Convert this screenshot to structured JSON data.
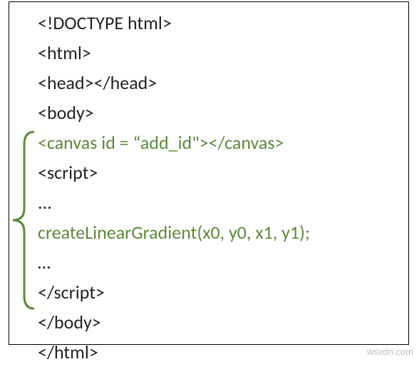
{
  "code": {
    "line1": "<!DOCTYPE html>",
    "line2": "<html>",
    "line3": "<head></head>",
    "line4": "<body>",
    "line5": "<canvas id = “add_id\"></canvas>",
    "line6": "<script>",
    "line7": " ...",
    "line8": " createLinearGradient(x0, y0, x1, y1);",
    "line9": " …",
    "line10": "</script>",
    "line11": "</body>",
    "line12": "</html>"
  },
  "watermark": "wsxdn.com",
  "colors": {
    "highlight": "#5b8a3a",
    "text": "#222222",
    "bracket": "#5b8a3a"
  }
}
